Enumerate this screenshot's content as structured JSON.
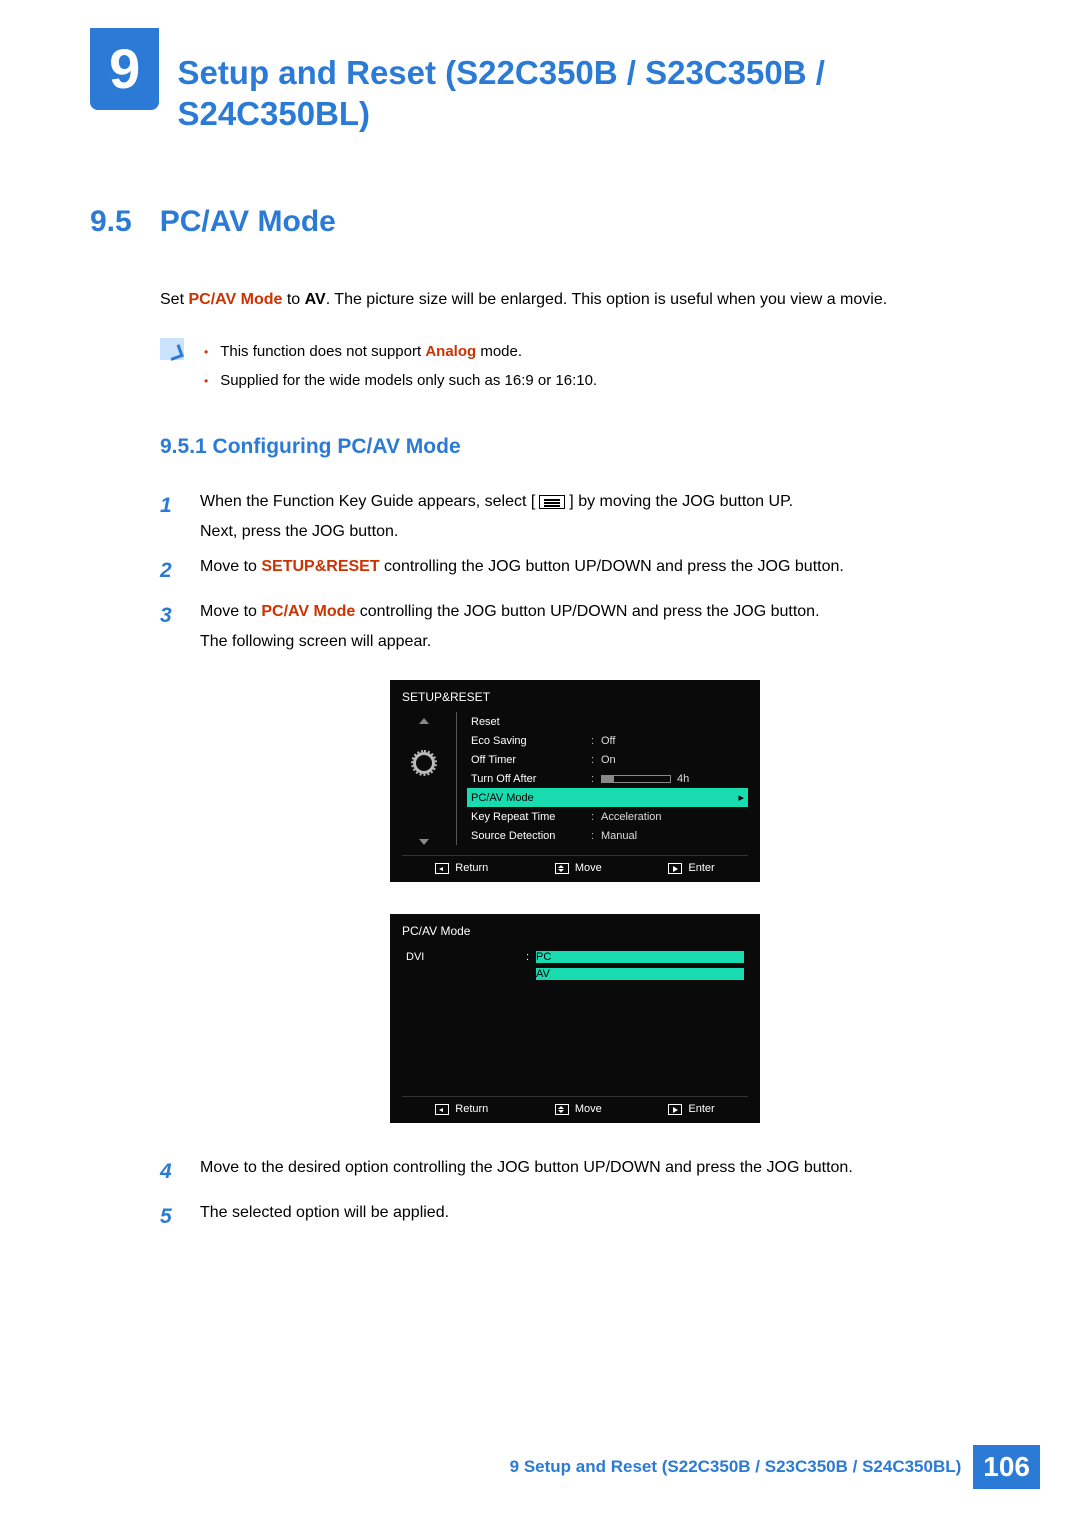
{
  "chapter": {
    "number": "9",
    "title": "Setup and Reset (S22C350B / S23C350B / S24C350BL)"
  },
  "section": {
    "number": "9.5",
    "title": "PC/AV Mode",
    "intro_pre": "Set ",
    "intro_bold1": "PC/AV Mode",
    "intro_mid": " to ",
    "intro_bold2": "AV",
    "intro_post": ". The picture size will be enlarged. This option is useful when you view a movie."
  },
  "notes": {
    "n1_pre": "This function does not support ",
    "n1_bold": "Analog",
    "n1_post": " mode.",
    "n2": "Supplied for the wide models only such as 16:9 or 16:10."
  },
  "subsection": "9.5.1   Configuring PC/AV Mode",
  "steps": {
    "s1a": "When the Function Key Guide appears, select [",
    "s1b": "] by moving the JOG button UP.",
    "s1c": "Next, press the JOG button.",
    "s2a": "Move to ",
    "s2b": "SETUP&RESET",
    "s2c": " controlling the JOG button UP/DOWN and press the JOG button.",
    "s3a": "Move to ",
    "s3b": "PC/AV Mode",
    "s3c": " controlling the JOG button UP/DOWN and press the JOG button.",
    "s3d": "The following screen will appear.",
    "s4": "Move to the desired option controlling the JOG button UP/DOWN and press the JOG button.",
    "s5": "The selected option will be applied."
  },
  "osd1": {
    "title": "SETUP&RESET",
    "rows": [
      {
        "label": "Reset",
        "val": ""
      },
      {
        "label": "Eco Saving",
        "val": "Off"
      },
      {
        "label": "Off Timer",
        "val": "On"
      },
      {
        "label": "Turn Off After",
        "val": "4h",
        "bar": true
      },
      {
        "label": "PC/AV Mode",
        "val": "",
        "selected": true,
        "caret": "▸"
      },
      {
        "label": "Key Repeat Time",
        "val": "Acceleration"
      },
      {
        "label": "Source Detection",
        "val": "Manual"
      }
    ],
    "footer": {
      "return": "Return",
      "move": "Move",
      "enter": "Enter"
    }
  },
  "osd2": {
    "title": "PC/AV Mode",
    "input_label": "DVI",
    "option_pc": "PC",
    "option_av": "AV",
    "footer": {
      "return": "Return",
      "move": "Move",
      "enter": "Enter"
    }
  },
  "footer": {
    "chapter_ref": "9 Setup and Reset (S22C350B / S23C350B / S24C350BL)",
    "page": "106"
  }
}
